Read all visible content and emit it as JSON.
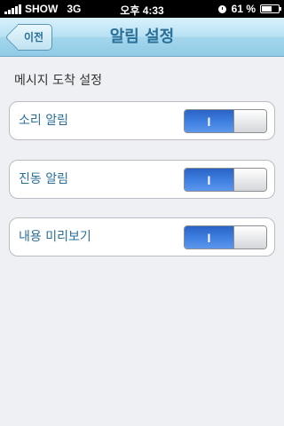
{
  "status_bar": {
    "carrier": "SHOW",
    "network": "3G",
    "time": "오후 4:33",
    "battery_percent": "61 %",
    "battery_level": 0.61
  },
  "nav": {
    "back_label": "이전",
    "title": "알림 설정"
  },
  "section": {
    "header": "메시지 도착 설정"
  },
  "settings": [
    {
      "label": "소리 알림",
      "toggle_text": "I",
      "on": true
    },
    {
      "label": "진동 알림",
      "toggle_text": "I",
      "on": true
    },
    {
      "label": "내용 미리보기",
      "toggle_text": "I",
      "on": true
    }
  ],
  "colors": {
    "nav_title": "#2a6f97",
    "toggle_on": "#3d7ee0",
    "background": "#eef0f4"
  }
}
